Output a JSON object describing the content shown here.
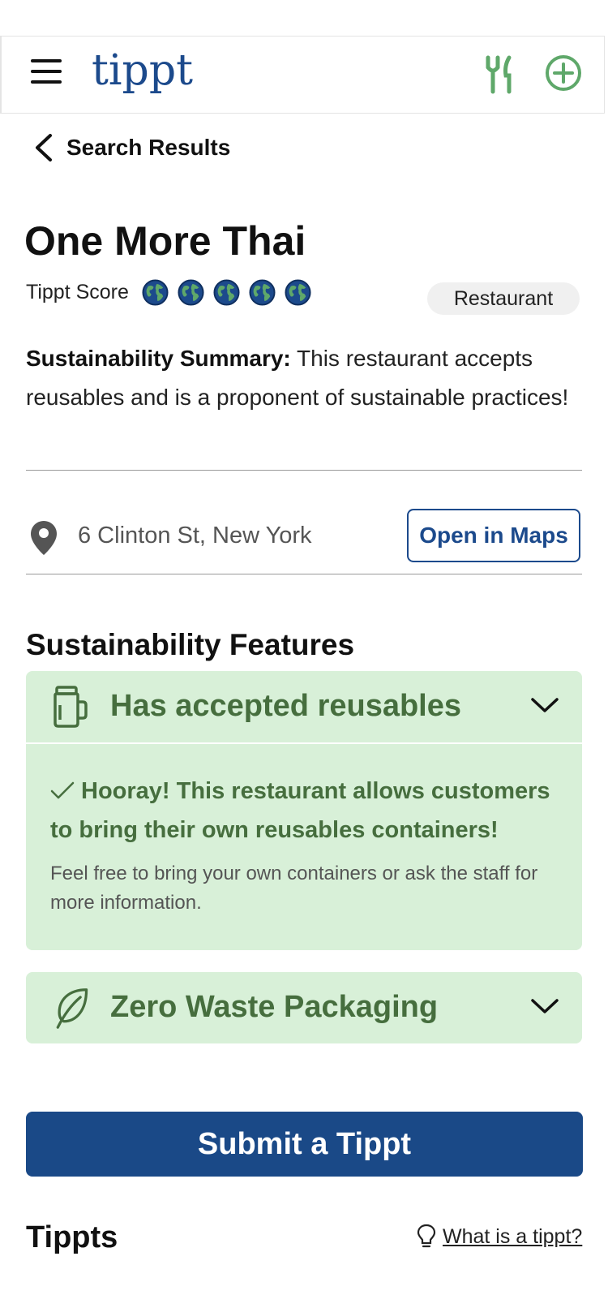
{
  "header": {
    "logo": "tippt",
    "menu_icon": "hamburger-menu-icon",
    "restaurant_icon": "fork-knife-icon",
    "add_icon": "plus-circle-icon",
    "accent_color": "#5fa86a"
  },
  "nav": {
    "back_label": "Search Results"
  },
  "place": {
    "name": "One More Thai",
    "score_label": "Tippt Score",
    "score": 5,
    "score_max": 5,
    "category": "Restaurant",
    "summary_label": "Sustainability Summary:",
    "summary_text": " This restaurant accepts reusables and is a proponent of sustainable practices!",
    "address": "6 Clinton St, New York",
    "maps_button": "Open in Maps"
  },
  "features": {
    "section_title": "Sustainability Features",
    "items": [
      {
        "title": "Has accepted reusables",
        "icon": "jar-icon",
        "expanded": true,
        "detail_title": "Hooray! This restaurant allows customers to bring their own reusables containers!",
        "detail_note": "Feel free to bring your own containers or ask the staff for more information."
      },
      {
        "title": "Zero Waste Packaging",
        "icon": "leaf-icon",
        "expanded": false
      }
    ]
  },
  "actions": {
    "submit_label": "Submit a Tippt"
  },
  "tippts": {
    "title": "Tippts",
    "help_link": "What is a tippt?"
  },
  "colors": {
    "brand_blue": "#1a4987",
    "feature_bg": "#d8f0d8",
    "feature_text": "#466e3e"
  }
}
